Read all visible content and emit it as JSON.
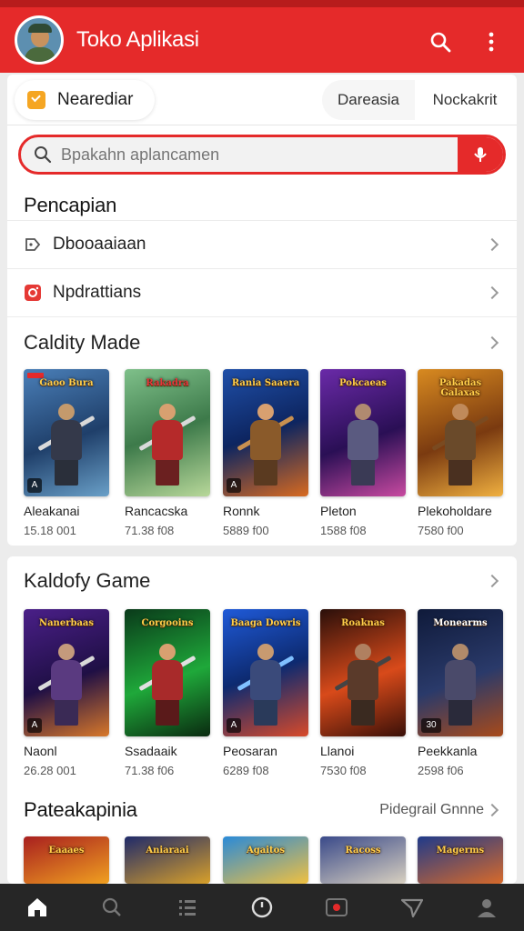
{
  "app": {
    "title": "Toko Aplikasi",
    "colors": {
      "primary": "#e52a2a",
      "statusbar": "#b71c1c",
      "nav": "#262626"
    }
  },
  "tabs": [
    {
      "label": "Nearediar",
      "icon": "check-badge-icon",
      "active": true
    },
    {
      "label": "Dareasia"
    },
    {
      "label": "Nockakrit"
    }
  ],
  "search": {
    "placeholder": "Bpakahn aplancamen",
    "button_icon": "voice-icon"
  },
  "pencapian": {
    "title": "Pencapian",
    "items": [
      {
        "label": "Dbooaaiaan",
        "icon": "tag-icon"
      },
      {
        "label": "Npdrattians",
        "icon": "instagram-icon"
      }
    ]
  },
  "section1": {
    "title": "Caldity Made",
    "games": [
      {
        "name": "Aleakanai",
        "meta": "15.18 001",
        "cover": "Gaoo Bura",
        "badge": "A"
      },
      {
        "name": "Rancacska",
        "meta": "71.38 f08",
        "cover": "Rakadra",
        "badge": ""
      },
      {
        "name": "Ronnk",
        "meta": "5889 f00",
        "cover": "Rania Saaera",
        "badge": "A"
      },
      {
        "name": "Pleton",
        "meta": "1588 f08",
        "cover": "Pokcaeas",
        "badge": ""
      },
      {
        "name": "Plekoholdare",
        "meta": "7580 f00",
        "cover": "Pakadas Galaxas",
        "badge": ""
      }
    ]
  },
  "section2": {
    "title": "Kaldofy Game",
    "games": [
      {
        "name": "Naonl",
        "meta": "26.28 001",
        "cover": "Nanerbaas",
        "badge": "A"
      },
      {
        "name": "Ssadaaik",
        "meta": "71.38 f06",
        "cover": "Corgooins",
        "badge": ""
      },
      {
        "name": "Peosaran",
        "meta": "6289 f08",
        "cover": "Baaga Dowris",
        "badge": "A"
      },
      {
        "name": "Llanoi",
        "meta": "7530 f08",
        "cover": "Roaknas",
        "badge": ""
      },
      {
        "name": "Peekkanla",
        "meta": "2598 f06",
        "cover": "Monearms",
        "badge": "30"
      }
    ]
  },
  "section3": {
    "title": "Pateakapinia",
    "see_all": "Pidegrail Gnnne",
    "covers": [
      "Eaaaes",
      "Aniaraai",
      "Agaitos",
      "Racoss",
      "Magerms"
    ]
  },
  "bottom_nav": [
    {
      "icon": "home-icon",
      "active": true
    },
    {
      "icon": "search-icon"
    },
    {
      "icon": "list-icon"
    },
    {
      "icon": "clock-icon"
    },
    {
      "icon": "play-icon"
    },
    {
      "icon": "send-icon"
    },
    {
      "icon": "person-icon"
    }
  ]
}
